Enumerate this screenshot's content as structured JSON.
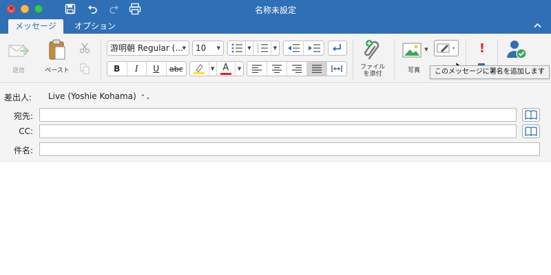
{
  "window": {
    "title": "名称未設定"
  },
  "tabs": [
    {
      "label": "メッセージ",
      "active": true
    },
    {
      "label": "オプション",
      "active": false
    }
  ],
  "ribbon": {
    "send_label": "送信",
    "paste_label": "ペースト",
    "font_name": "游明朝 Regular (...",
    "font_size": "10",
    "bold": "B",
    "italic": "I",
    "underline": "U",
    "strike": "abc",
    "font_color_letter": "A",
    "attach_label_line1": "ファイル",
    "attach_label_line2": "を添付",
    "photo_label": "写真",
    "importance_mark": "!"
  },
  "tooltip": "このメッセージに署名を追加します",
  "header": {
    "from_label": "差出人:",
    "from_value": "Live (Yoshie Kohama)",
    "to_label": "宛先:",
    "cc_label": "CC:",
    "subject_label": "件名:",
    "to_value": "",
    "cc_value": "",
    "subject_value": ""
  },
  "colors": {
    "titlebar": "#2f6fb6",
    "highlight": "#ffe600",
    "font_color": "#e02020",
    "importance": "#e0282e",
    "accent_green": "#3aa857"
  }
}
